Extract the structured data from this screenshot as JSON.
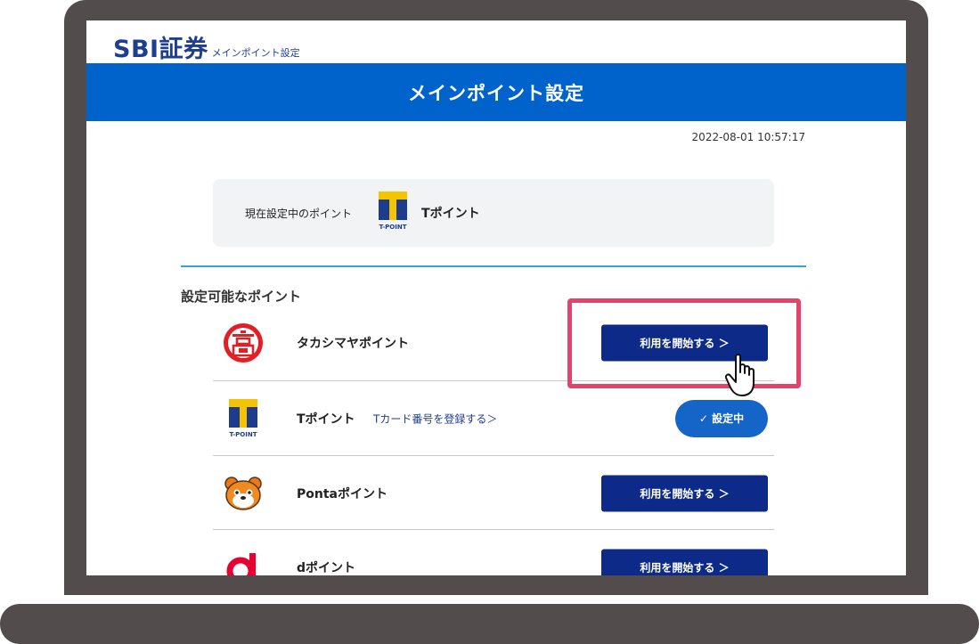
{
  "header": {
    "brand": "SBI証券",
    "brand_sub": "メインポイント設定",
    "title": "メインポイント設定"
  },
  "timestamp": "2022-08-01 10:57:17",
  "current": {
    "label": "現在設定中のポイント",
    "name": "Tポイント",
    "logo_caption": "T-POINT"
  },
  "section_title": "設定可能なポイント",
  "points": [
    {
      "name": "タカシマヤポイント",
      "icon": "takashimaya-icon",
      "button": "利用を開始する ＞"
    },
    {
      "name": "Tポイント",
      "icon": "tpoint-icon",
      "link": "Tカード番号を登録する＞",
      "status": "✓ 設定中"
    },
    {
      "name": "Pontaポイント",
      "icon": "ponta-icon",
      "button": "利用を開始する ＞"
    },
    {
      "name": "dポイント",
      "icon": "dpoint-icon",
      "button": "利用を開始する ＞"
    }
  ],
  "colors": {
    "brand_blue": "#0063cc",
    "button_navy": "#0d2a88",
    "status_blue": "#1565c8",
    "highlight": "#e4436b",
    "divider": "#3aa0d8",
    "bezel": "#524c4c"
  }
}
